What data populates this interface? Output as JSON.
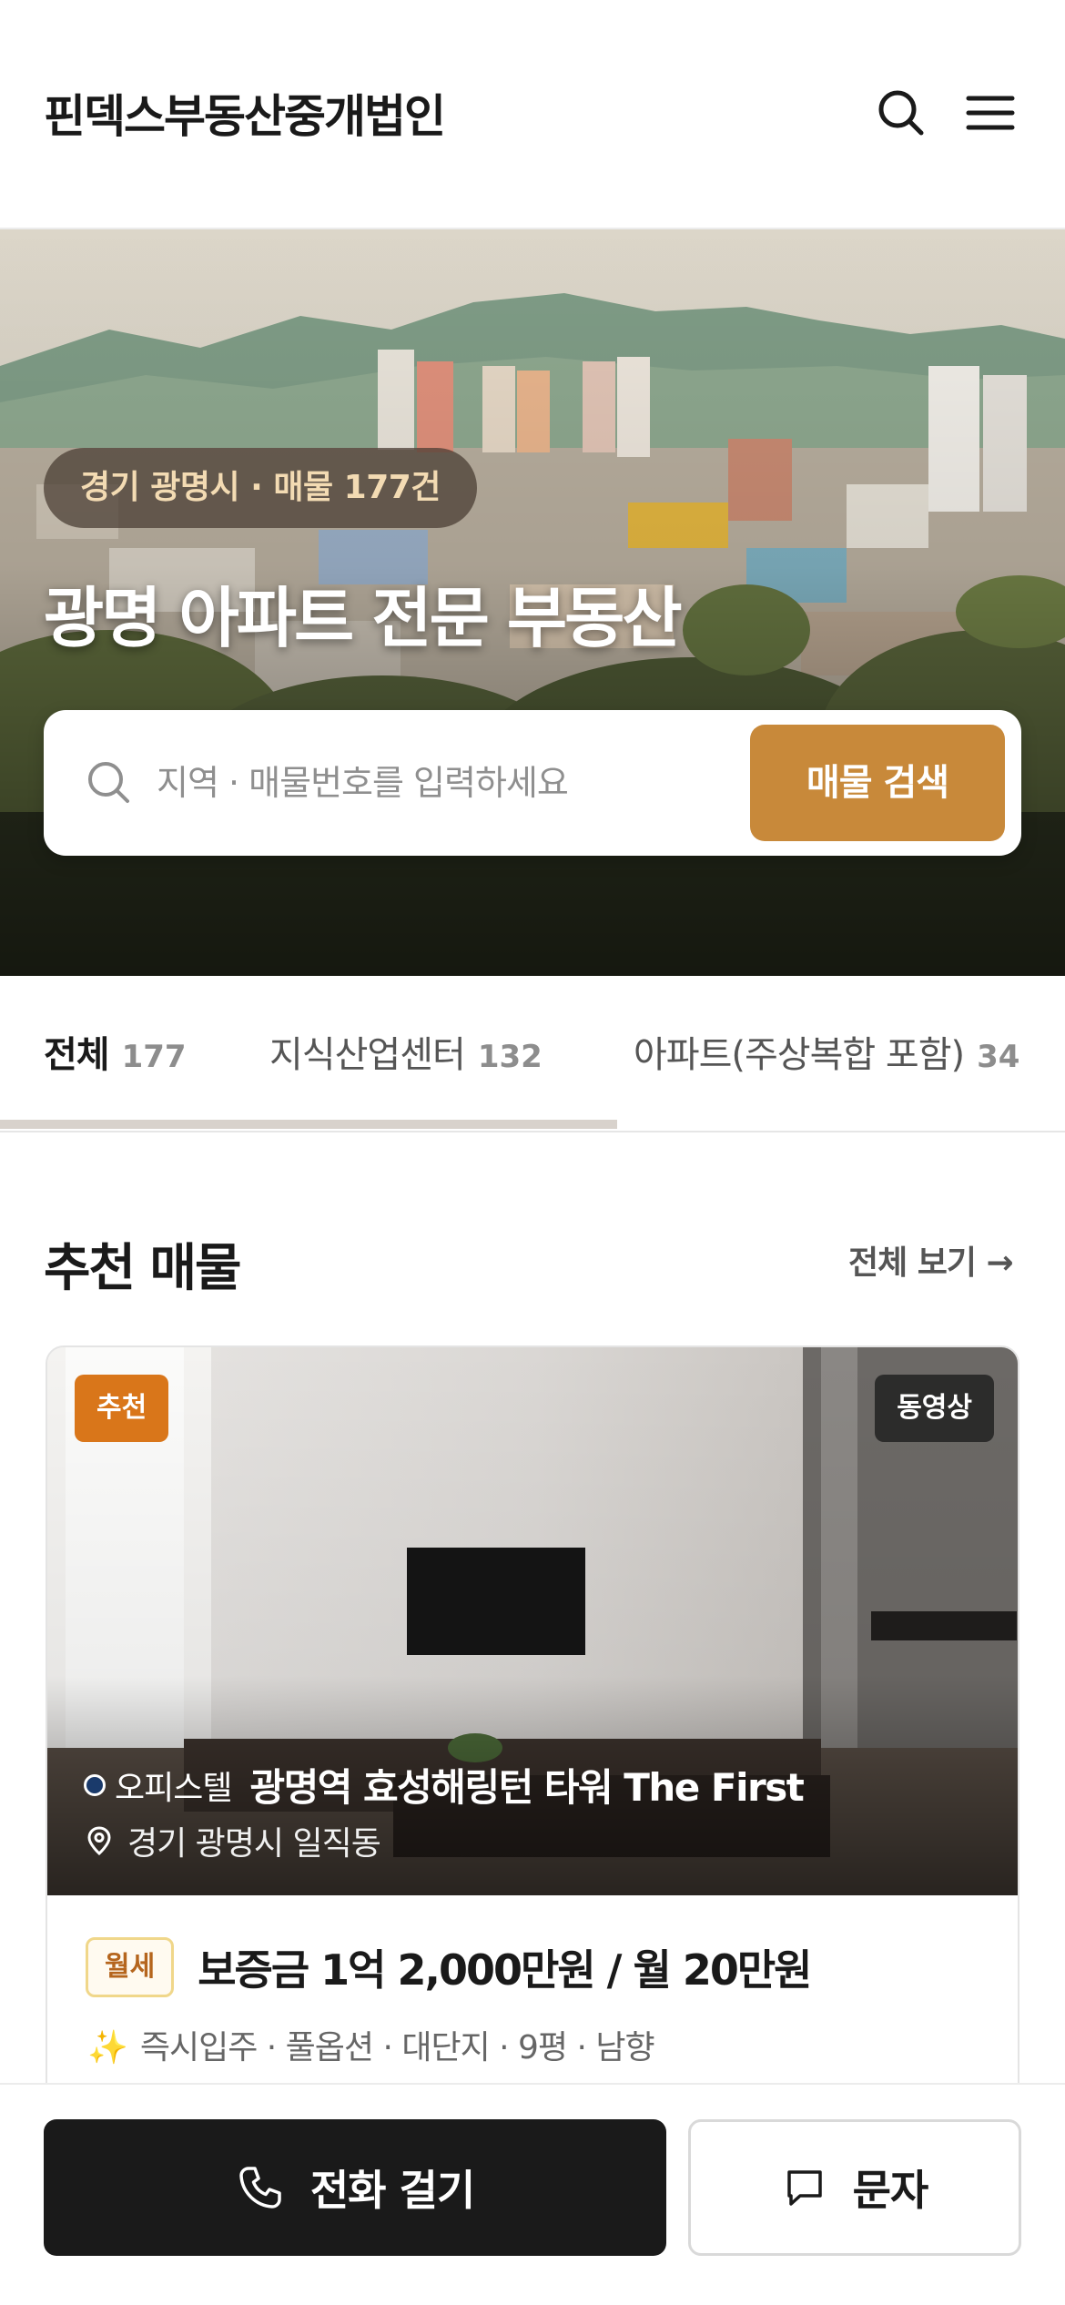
{
  "header": {
    "brand": "핀덱스부동산중개법인",
    "icons": [
      "search-icon",
      "menu-icon"
    ]
  },
  "hero": {
    "badge": "경기 광명시 · 매물 177건",
    "title": "광명 아파트 전문 부동산",
    "search": {
      "placeholder": "지역 · 매물번호를 입력하세요",
      "button": "매물 검색"
    }
  },
  "tabs": [
    {
      "label": "전체",
      "count": "177",
      "active": true
    },
    {
      "label": "지식산업센터",
      "count": "132",
      "active": false
    },
    {
      "label": "아파트(주상복합 포함)",
      "count": "34",
      "active": false
    }
  ],
  "section": {
    "title": "추천 매물",
    "more": "전체 보기 →"
  },
  "card": {
    "badge_recommend": "추천",
    "badge_video": "동영상",
    "type": "오피스텔",
    "name": "광명역 효성해링턴 타워 The First",
    "location": "경기 광명시 일직동",
    "deal": "월세",
    "price": "보증금 1억 2,000만원 / 월 20만원",
    "features": "즉시입주 · 풀옵션 · 대단지 · 9평 · 남향"
  },
  "bottom": {
    "call": "전화 걸기",
    "sms": "문자"
  },
  "colors": {
    "accent": "#c8893a",
    "recommend_badge": "#d9761a",
    "dark": "#1a1a1a"
  }
}
